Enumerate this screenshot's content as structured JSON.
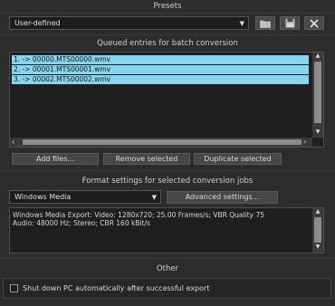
{
  "presets": {
    "title": "Presets",
    "selected": "User-defined",
    "icons": [
      "folder-icon",
      "save-icon",
      "close-icon"
    ]
  },
  "queue": {
    "title": "Queued entries for batch conversion",
    "entries": [
      "1.  -> 00000.MTS00000.wmv",
      "2.  -> 00001.MTS00001.wmv",
      "3.  -> 00002.MTS00002.wmv"
    ],
    "buttons": {
      "add": "Add files...",
      "remove": "Remove selected",
      "duplicate": "Duplicate selected"
    }
  },
  "format": {
    "title": "Format settings for selected conversion jobs",
    "selected": "Windows Media",
    "advanced": "Advanced settings...",
    "description_line1": "Windows Media Export: Video: 1280x720; 25.00 Frames/s; VBR Quality 75",
    "description_line2": "Audio: 48000 Hz; Stereo; CBR 160 kBit/s"
  },
  "other": {
    "title": "Other",
    "shutdown_label": "Shut down PC automatically after successful export",
    "shutdown_checked": false
  },
  "colors": {
    "background": "#2c2c2c",
    "selection": "#86d4ee"
  }
}
